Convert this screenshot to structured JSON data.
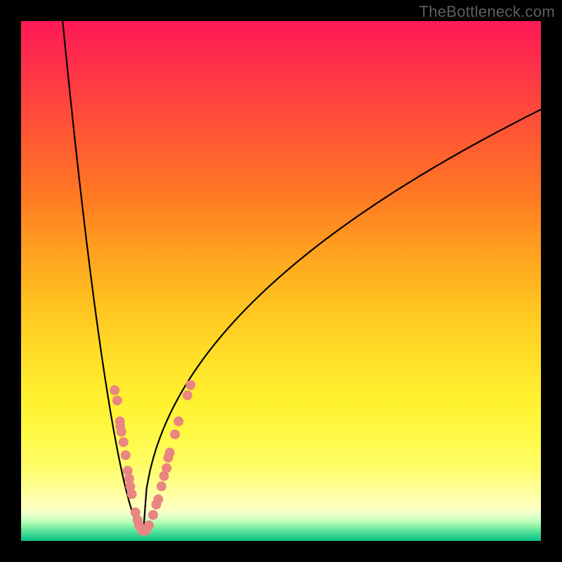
{
  "watermark": "TheBottleneck.com",
  "colors": {
    "curve_stroke": "#000000",
    "marker_fill": "#e98682",
    "frame_bg": "#000000"
  },
  "chart_data": {
    "type": "line",
    "title": "",
    "xlabel": "",
    "ylabel": "",
    "xlim": [
      0,
      100
    ],
    "ylim": [
      0,
      100
    ],
    "curve": {
      "minimum_x": 23.5,
      "left_branch_top_x": 8,
      "right_branch_top_x": 100,
      "right_branch_top_y": 83
    },
    "markers": [
      {
        "x": 18.0,
        "y": 29.0
      },
      {
        "x": 18.5,
        "y": 27.0
      },
      {
        "x": 19.0,
        "y": 23.0
      },
      {
        "x": 19.1,
        "y": 22.0
      },
      {
        "x": 19.3,
        "y": 21.0
      },
      {
        "x": 19.7,
        "y": 19.0
      },
      {
        "x": 20.1,
        "y": 16.5
      },
      {
        "x": 20.5,
        "y": 13.5
      },
      {
        "x": 20.8,
        "y": 12.0
      },
      {
        "x": 21.0,
        "y": 10.5
      },
      {
        "x": 21.3,
        "y": 9.0
      },
      {
        "x": 22.0,
        "y": 5.5
      },
      {
        "x": 22.4,
        "y": 4.0
      },
      {
        "x": 22.7,
        "y": 3.0
      },
      {
        "x": 23.3,
        "y": 2.0
      },
      {
        "x": 24.0,
        "y": 2.0
      },
      {
        "x": 24.6,
        "y": 3.0
      },
      {
        "x": 25.4,
        "y": 5.0
      },
      {
        "x": 26.0,
        "y": 7.0
      },
      {
        "x": 26.4,
        "y": 8.0
      },
      {
        "x": 27.0,
        "y": 10.5
      },
      {
        "x": 27.5,
        "y": 12.5
      },
      {
        "x": 28.0,
        "y": 14.0
      },
      {
        "x": 28.3,
        "y": 16.0
      },
      {
        "x": 28.6,
        "y": 17.0
      },
      {
        "x": 29.6,
        "y": 20.5
      },
      {
        "x": 30.3,
        "y": 23.0
      },
      {
        "x": 32.0,
        "y": 28.0
      },
      {
        "x": 32.6,
        "y": 30.0
      }
    ]
  }
}
